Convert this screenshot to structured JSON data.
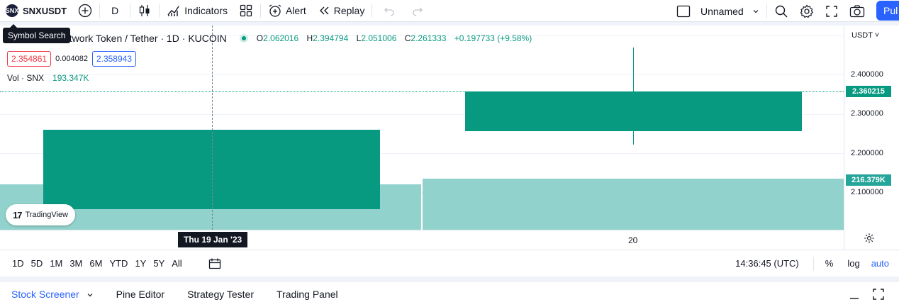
{
  "toolbar": {
    "symbol": "SNXUSDT",
    "symbol_logo": "SNX",
    "interval": "D",
    "indicators_label": "Indicators",
    "alert_label": "Alert",
    "replay_label": "Replay",
    "layout_name": "Unnamed",
    "publish_label": "Pul"
  },
  "tooltip": "Symbol Search",
  "legend": {
    "title": "etwork Token / Tether · 1D · KUCOIN",
    "o_label": "O",
    "o": "2.062016",
    "h_label": "H",
    "h": "2.394794",
    "l_label": "L",
    "l": "2.051006",
    "c_label": "C",
    "c": "2.261333",
    "change": "+0.197733 (+9.58%)",
    "sell": "2.354861",
    "spread": "0.004082",
    "buy": "2.358943",
    "vol_label": "Vol · SNX",
    "vol_value": "193.347K"
  },
  "branding": "TradingView",
  "price_scale": {
    "currency": "USDT",
    "ticks": [
      "2.400000",
      "2.300000",
      "2.200000",
      "2.100000"
    ],
    "last_price": "2.360215",
    "last_volume": "216.379K"
  },
  "time_axis": {
    "crosshair_label": "Thu 19 Jan '23",
    "tick": "20"
  },
  "range_bar": {
    "ranges": [
      "1D",
      "5D",
      "1M",
      "3M",
      "6M",
      "YTD",
      "1Y",
      "5Y",
      "All"
    ],
    "clock": "14:36:45 (UTC)",
    "percent": "%",
    "log": "log",
    "auto": "auto"
  },
  "bottom_panel": {
    "tabs": [
      "Stock Screener",
      "Pine Editor",
      "Strategy Tester",
      "Trading Panel"
    ]
  },
  "chart_data": {
    "type": "candlestick",
    "bars": [
      {
        "date": "Thu 19 Jan '23",
        "open": 2.062016,
        "high": 2.394794,
        "low": 2.051006,
        "close": 2.261333,
        "volume": 193347
      },
      {
        "date": "20",
        "open": 2.261333,
        "high": 2.47,
        "low": 2.22,
        "close": 2.360215,
        "volume": 216379
      }
    ],
    "y_ticks": [
      2.4,
      2.3,
      2.2,
      2.1
    ],
    "colors": {
      "up": "#089981",
      "volume": "#92d2cc"
    }
  }
}
